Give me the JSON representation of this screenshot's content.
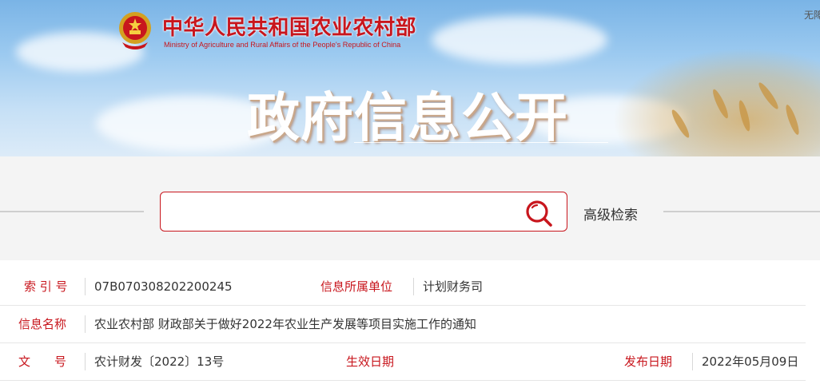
{
  "header": {
    "ministry_cn": "中华人民共和国农业农村部",
    "ministry_en": "Ministry of Agriculture and Rural Affairs of the People's Republic of China",
    "page_title": "政府信息公开",
    "topright_text": "无障"
  },
  "search": {
    "placeholder": "",
    "value": "",
    "icon": "search-icon",
    "advanced_label": "高级检索"
  },
  "info": {
    "index_label": "索 引 号",
    "index_value": "07B070308202200245",
    "unit_label": "信息所属单位",
    "unit_value": "计划财务司",
    "name_label": "信息名称",
    "name_value": "农业农村部 财政部关于做好2022年农业生产发展等项目实施工作的通知",
    "doc_label": "文　　号",
    "doc_value": "农计财发〔2022〕13号",
    "effective_label": "生效日期",
    "effective_value": "",
    "publish_label": "发布日期",
    "publish_value": "2022年05月09日"
  },
  "colors": {
    "brand_red": "#c8161d",
    "sky": "#9ccaf0"
  }
}
